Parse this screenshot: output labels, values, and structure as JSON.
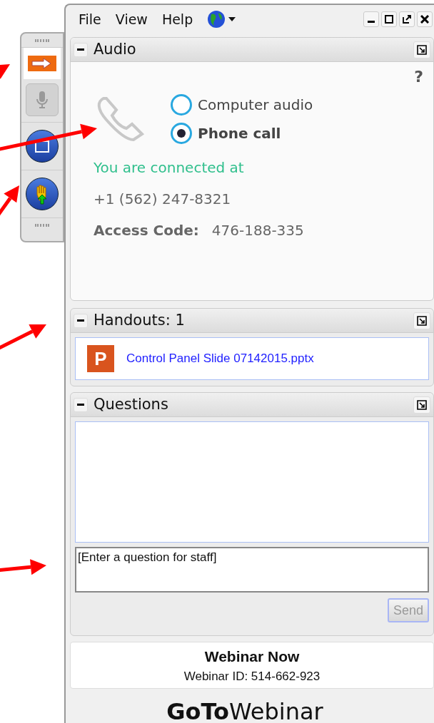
{
  "menu": [
    "File",
    "View",
    "Help"
  ],
  "audio": {
    "title": "Audio",
    "help": "?",
    "options": [
      {
        "label": "Computer audio",
        "selected": false
      },
      {
        "label": "Phone call",
        "selected": true
      }
    ],
    "status": "You are connected at",
    "phone": "+1 (562) 247-8321",
    "access_label": "Access Code:",
    "access_code": "476-188-335"
  },
  "handouts": {
    "title": "Handouts: 1",
    "files": [
      "Control Panel Slide 07142015.pptx"
    ],
    "file_icon": "P"
  },
  "questions": {
    "title": "Questions",
    "placeholder": "[Enter a question for staff]",
    "send": "Send"
  },
  "webinar": {
    "name": "Webinar Now",
    "id": "Webinar ID: 514-662-923"
  },
  "logo": "**GoTo**Webinar"
}
